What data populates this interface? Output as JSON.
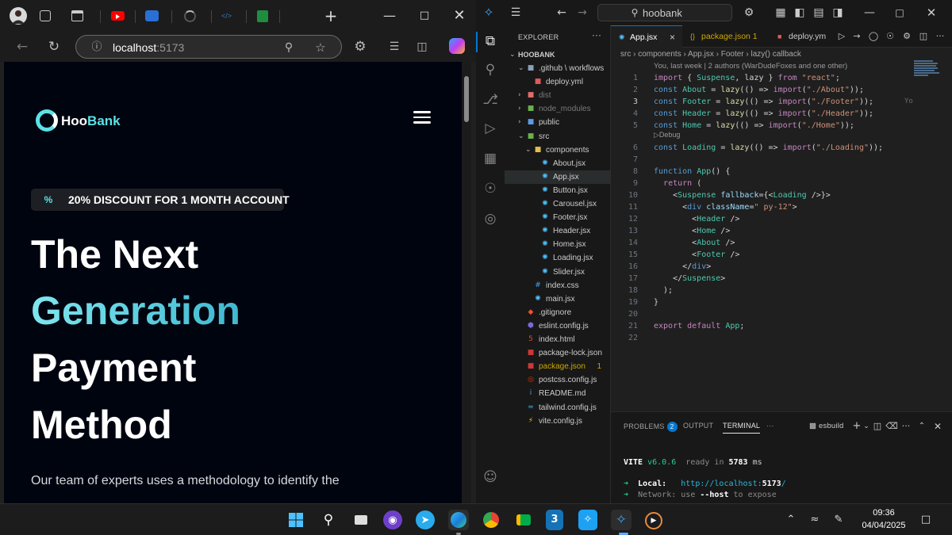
{
  "browser": {
    "url_host": "localhost",
    "url_port": ":5173",
    "page": {
      "logo_hoo": "Hoo",
      "logo_bank": "Bank",
      "discount": "20% DISCOUNT FOR 1 MONTH ACCOUNT",
      "discount_icon": "%",
      "hero_line1": "The Next",
      "hero_line2": "Generation",
      "hero_line3": "Payment",
      "hero_line4": "Method",
      "description": "Our team of experts uses a methodology to identify the"
    }
  },
  "vscode": {
    "search": "hoobank",
    "explorer_title": "EXPLORER",
    "project": "HOOBANK",
    "tree": [
      {
        "label": ".github \\ workflows",
        "depth": 1,
        "chev": "⌄",
        "icon": "folder",
        "color": "#ccc"
      },
      {
        "label": "deploy.yml",
        "depth": 2,
        "chev": "",
        "icon": "yml",
        "color": "#ccc"
      },
      {
        "label": "dist",
        "depth": 1,
        "chev": "›",
        "icon": "folder-red",
        "color": "#7a7a7a"
      },
      {
        "label": "node_modules",
        "depth": 1,
        "chev": "›",
        "icon": "folder-green",
        "color": "#7a7a7a"
      },
      {
        "label": "public",
        "depth": 1,
        "chev": "›",
        "icon": "folder-blue",
        "color": "#ccc"
      },
      {
        "label": "src",
        "depth": 1,
        "chev": "⌄",
        "icon": "folder-green",
        "color": "#ccc"
      },
      {
        "label": "components",
        "depth": 2,
        "chev": "⌄",
        "icon": "folder-yellow",
        "color": "#ccc"
      },
      {
        "label": "About.jsx",
        "depth": 3,
        "chev": "",
        "icon": "react",
        "color": "#ccc"
      },
      {
        "label": "App.jsx",
        "depth": 3,
        "chev": "",
        "icon": "react",
        "color": "#ccc",
        "selected": true
      },
      {
        "label": "Button.jsx",
        "depth": 3,
        "chev": "",
        "icon": "react",
        "color": "#ccc"
      },
      {
        "label": "Carousel.jsx",
        "depth": 3,
        "chev": "",
        "icon": "react",
        "color": "#ccc"
      },
      {
        "label": "Footer.jsx",
        "depth": 3,
        "chev": "",
        "icon": "react",
        "color": "#ccc"
      },
      {
        "label": "Header.jsx",
        "depth": 3,
        "chev": "",
        "icon": "react",
        "color": "#ccc"
      },
      {
        "label": "Home.jsx",
        "depth": 3,
        "chev": "",
        "icon": "react",
        "color": "#ccc"
      },
      {
        "label": "Loading.jsx",
        "depth": 3,
        "chev": "",
        "icon": "react",
        "color": "#ccc"
      },
      {
        "label": "Slider.jsx",
        "depth": 3,
        "chev": "",
        "icon": "react",
        "color": "#ccc"
      },
      {
        "label": "index.css",
        "depth": 2,
        "chev": "",
        "icon": "css",
        "color": "#ccc"
      },
      {
        "label": "main.jsx",
        "depth": 2,
        "chev": "",
        "icon": "react",
        "color": "#ccc"
      },
      {
        "label": ".gitignore",
        "depth": 1,
        "chev": "",
        "icon": "git",
        "color": "#ccc"
      },
      {
        "label": "eslint.config.js",
        "depth": 1,
        "chev": "",
        "icon": "eslint",
        "color": "#ccc"
      },
      {
        "label": "index.html",
        "depth": 1,
        "chev": "",
        "icon": "html",
        "color": "#ccc"
      },
      {
        "label": "package-lock.json",
        "depth": 1,
        "chev": "",
        "icon": "npm",
        "color": "#ccc"
      },
      {
        "label": "package.json",
        "depth": 1,
        "chev": "",
        "icon": "npm",
        "color": "#cca700",
        "badge": "1"
      },
      {
        "label": "postcss.config.js",
        "depth": 1,
        "chev": "",
        "icon": "postcss",
        "color": "#ccc"
      },
      {
        "label": "README.md",
        "depth": 1,
        "chev": "",
        "icon": "info",
        "color": "#ccc"
      },
      {
        "label": "tailwind.config.js",
        "depth": 1,
        "chev": "",
        "icon": "tailwind",
        "color": "#ccc"
      },
      {
        "label": "vite.config.js",
        "depth": 1,
        "chev": "",
        "icon": "vite",
        "color": "#ccc"
      }
    ],
    "tabs": [
      {
        "label": "App.jsx",
        "close": "×",
        "active": true,
        "color": "#ffffff"
      },
      {
        "label": "package.json 1",
        "close": "",
        "active": false,
        "color": "#cca700"
      },
      {
        "label": "deploy.ym",
        "close": "",
        "active": false,
        "color": "#cccccc"
      }
    ],
    "breadcrumb": "src › components ›  App.jsx ›  Footer ›  lazy() callback",
    "blame": "You, last week | 2 authors (WarDudeFoxes and one other)",
    "codelens": "▷Debug",
    "current_line": 3,
    "inline_blame": "Yo",
    "code": [
      "import { Suspense, lazy } from \"react\";",
      "const About = lazy(() => import(\"./About\"));",
      "const Footer = lazy(() => import(\"./Footer\"));",
      "const Header = lazy(() => import(\"./Header\"));",
      "const Home = lazy(() => import(\"./Home\"));",
      "const Loading = lazy(() => import(\"./Loading\"));",
      "",
      "function App() {",
      "  return (",
      "    <Suspense fallback={<Loading />}>",
      "      <div className=\" py-12\">",
      "        <Header />",
      "        <Home />",
      "        <About />",
      "        <Footer />",
      "      </div>",
      "    </Suspense>",
      "  );",
      "}",
      "",
      "export default App;",
      ""
    ],
    "panel": {
      "problems": "PROBLEMS",
      "problems_count": "2",
      "output": "OUTPUT",
      "terminal": "TERMINAL",
      "more": "···",
      "shell": "esbuild"
    },
    "terminal": {
      "vite": "VITE",
      "version": "v6.0.6",
      "ready": "ready in",
      "ms": "5783",
      "ms_unit": "ms",
      "local_label": "Local:",
      "local_url_pre": "http://localhost:",
      "local_port": "5173",
      "local_url_post": "/",
      "network_label": "Network:",
      "network_use": "use",
      "network_flag": "--host",
      "network_rest": "to expose"
    }
  },
  "taskbar": {
    "time": "09:36",
    "date": "04/04/2025"
  }
}
